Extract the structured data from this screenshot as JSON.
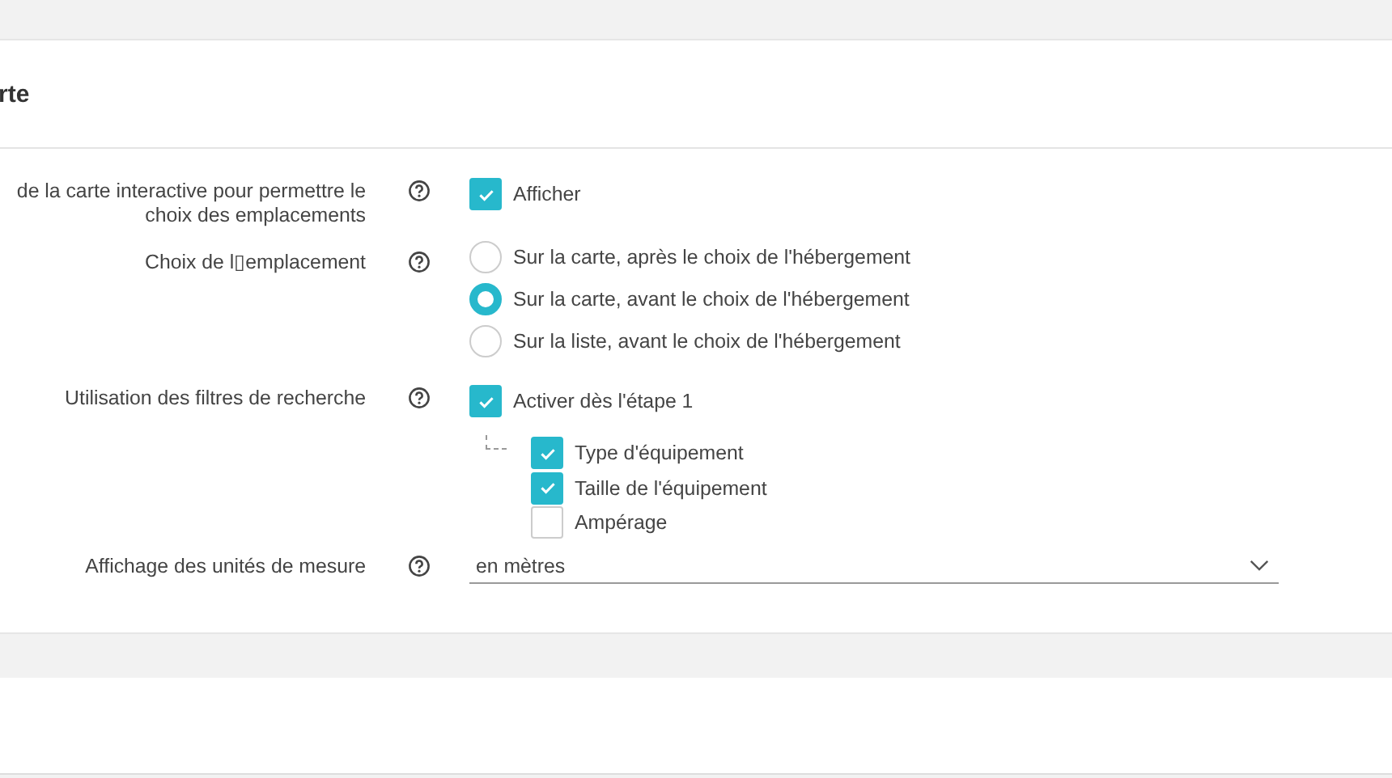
{
  "section": {
    "title": "rte"
  },
  "settings": [
    {
      "kind": "checkbox",
      "label": "de la carte interactive pour permettre le choix des emplacements",
      "options": [
        {
          "label": "Afficher",
          "checked": true
        }
      ]
    },
    {
      "kind": "radio",
      "label": "Choix de l▯emplacement",
      "options": [
        {
          "label": "Sur la carte, après le choix de l'hébergement",
          "selected": false
        },
        {
          "label": "Sur la carte, avant le choix de l'hébergement",
          "selected": true
        },
        {
          "label": "Sur la liste, avant le choix de l'hébergement",
          "selected": false
        }
      ]
    },
    {
      "kind": "checkbox",
      "label": "Utilisation des filtres de recherche",
      "options": [
        {
          "label": "Activer dès l'étape 1",
          "checked": true,
          "children": [
            {
              "label": "Type d'équipement",
              "checked": true
            },
            {
              "label": "Taille de l'équipement",
              "checked": true
            },
            {
              "label": "Ampérage",
              "checked": false
            }
          ]
        }
      ]
    },
    {
      "kind": "select",
      "label": "Affichage des unités de mesure",
      "value": "en mètres"
    }
  ]
}
